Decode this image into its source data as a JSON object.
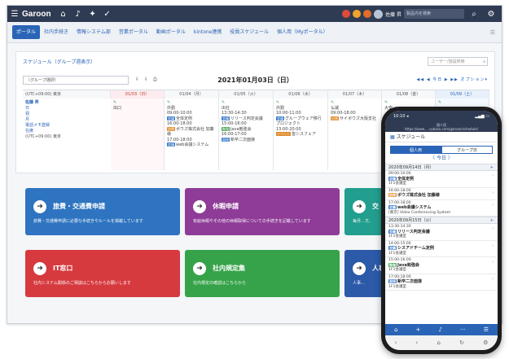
{
  "topbar": {
    "brand": "Garoon",
    "user_name": "佐藤 昇",
    "search_placeholder": "製品内を検索"
  },
  "nav": {
    "tabs": [
      "ポータル",
      "社内手続き",
      "情報システム部",
      "営業ポータル",
      "動画ポータル",
      "kintone連携",
      "役員スケジュール",
      "個人用（Myポータル）"
    ],
    "active_index": 0
  },
  "schedule": {
    "title": "スケジュール（グループ週表示）",
    "user_search_placeholder": "ユーザー/施設検索",
    "group_select": "（グループ選択）",
    "date_title": "2021年01月03日（日）",
    "nav_controls": "◀◀ ◀ 今日 ▶ ▶▶ オプション▾",
    "timezone": "(UTC+09:00) 東京",
    "days": [
      "01/03（日）",
      "01/04（月）",
      "01/05（火）",
      "01/06（水）",
      "01/07（木）",
      "01/08（金）",
      "01/09（土）"
    ],
    "user_column": {
      "name": "佐藤 昇",
      "links": [
        "日",
        "週",
        "月",
        "電話メモ登録",
        "在席",
        "(UTC+09:00) 東京"
      ]
    },
    "cells": [
      {
        "status": "出口",
        "events": []
      },
      {
        "status": "外勤",
        "events": [
          {
            "time": "09:00-10:00",
            "tag": "会議",
            "title": "全体定例"
          },
          {
            "time": "16:00-18:00",
            "tag": "訪問",
            "title": "ボウズ株式会社 加藤様"
          },
          {
            "time": "17:00-18:00",
            "tag": "会議",
            "title": "web会議システム"
          }
        ]
      },
      {
        "status": "出社",
        "events": [
          {
            "time": "13:30-14:30",
            "tag": "会議",
            "title": "リリース判定会議"
          },
          {
            "time": "15:00-16:00",
            "tag": "勉強",
            "title": "Java勉強会"
          },
          {
            "time": "16:00-17:00",
            "tag": "面接",
            "title": "新卒二次面接"
          }
        ]
      },
      {
        "status": "外勤",
        "events": [
          {
            "time": "10:00-11:00",
            "tag": "会議",
            "title": "グループウェア移行プロジェクト"
          },
          {
            "time": "13:00-20:00",
            "tag": "イベント",
            "title": "皆シスフェア"
          }
        ]
      },
      {
        "status": "仏滅",
        "events": [
          {
            "time": "09:00-18:00",
            "tag": "出張",
            "title": "サイボウズ大阪支社"
          }
        ]
      },
      {
        "status": "大安",
        "events": []
      },
      {
        "status": "",
        "events": []
      }
    ]
  },
  "cards": [
    {
      "title": "旅費・交通費申請",
      "desc": "旅費・交通費申請に必要な手続きやルールを掲載しています",
      "color": "#2e74c0"
    },
    {
      "title": "休暇申請",
      "desc": "有給休暇やその他の休暇取得についての手続きを記載しています",
      "color": "#8e3c97"
    },
    {
      "title": "交",
      "desc": "毎月…す。",
      "color": "#229e8e"
    },
    {
      "title": "IT窓口",
      "desc": "社内システム関係のご相談はこちらからお願いします",
      "color": "#d63a3f"
    },
    {
      "title": "社内規定集",
      "desc": "社内規定の確認はこちらから",
      "color": "#36a34a"
    },
    {
      "title": "人事",
      "desc": "人事…",
      "color": "#2c5aa8"
    }
  ],
  "phone": {
    "status_time": "10:10 ◂",
    "url": "個人用",
    "url_sub": "https://www.....cybozu.com/garoon/schedule/",
    "header": "スケジュール",
    "toggle": [
      "個人用",
      "グループ日"
    ],
    "date_nav": "〈 今日 〉",
    "days": [
      {
        "label": "2020年09月14日（月）",
        "items": [
          {
            "time": "09:00-10:00",
            "tag": "会議",
            "title": "全体定例",
            "sub": "1F1会議室"
          },
          {
            "time": "16:00-18:00",
            "tag": "訪問",
            "title": "ボウズ株式会社 加藤様",
            "sub": ""
          },
          {
            "time": "17:00-18:00",
            "tag": "会議",
            "title": "web会議システム",
            "sub": "[東京] Video Conferencing System"
          }
        ]
      },
      {
        "label": "2020年09月15日（火）",
        "items": [
          {
            "time": "13:30-14:30",
            "tag": "会議",
            "title": "リリース判定会議",
            "sub": "1F1会議室"
          },
          {
            "time": "14:00-15:00",
            "tag": "会議",
            "title": "シスアドチーム定例",
            "sub": "1F1会議室"
          },
          {
            "time": "15:00-16:00",
            "tag": "勉強",
            "title": "Java勉強会",
            "sub": "1F1会議室"
          },
          {
            "time": "17:00-18:00",
            "tag": "面接",
            "title": "新卒二次面接",
            "sub": "1F1会議室"
          }
        ]
      }
    ]
  }
}
